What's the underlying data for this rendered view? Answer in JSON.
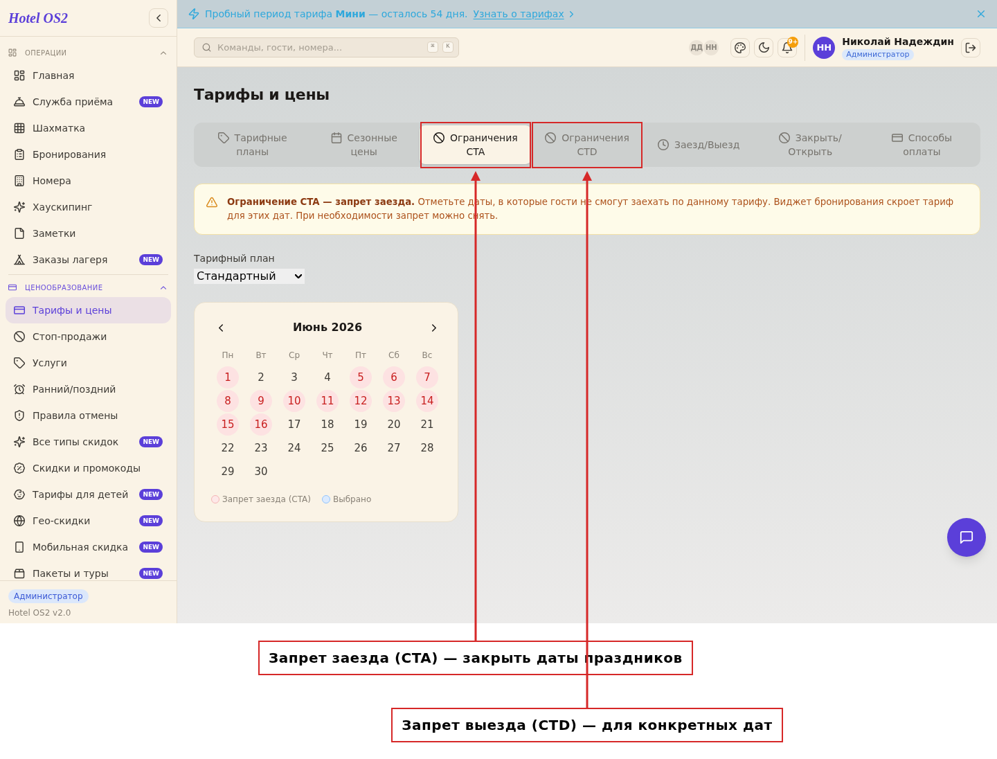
{
  "sidebar": {
    "logo": "Hotel OS2",
    "sections": [
      {
        "title": "ОПЕРАЦИИ",
        "expanded": true,
        "items": [
          {
            "label": "Главная",
            "selected": false
          },
          {
            "label": "Служба приёма",
            "badge": "NEW",
            "selected": false
          },
          {
            "label": "Шахматка",
            "selected": false
          },
          {
            "label": "Бронирования",
            "selected": false
          },
          {
            "label": "Номера",
            "selected": false
          },
          {
            "label": "Хаускипинг",
            "selected": false
          },
          {
            "label": "Заметки",
            "selected": false
          },
          {
            "label": "Заказы лагеря",
            "badge": "NEW",
            "selected": false
          }
        ]
      },
      {
        "title": "ЦЕНООБРАЗОВАНИЕ",
        "expanded": true,
        "items": [
          {
            "label": "Тарифы и цены",
            "selected": true
          },
          {
            "label": "Стоп-продажи",
            "selected": false
          },
          {
            "label": "Услуги",
            "selected": false
          },
          {
            "label": "Ранний/поздний",
            "selected": false
          },
          {
            "label": "Правила отмены",
            "selected": false
          },
          {
            "label": "Все типы скидок",
            "badge": "NEW",
            "selected": false
          },
          {
            "label": "Скидки и промокоды",
            "selected": false
          },
          {
            "label": "Тарифы для детей",
            "badge": "NEW",
            "selected": false
          },
          {
            "label": "Гео-скидки",
            "badge": "NEW",
            "selected": false
          },
          {
            "label": "Мобильная скидка",
            "badge": "NEW",
            "selected": false
          },
          {
            "label": "Пакеты и туры",
            "badge": "NEW",
            "selected": false
          }
        ]
      }
    ],
    "footer": {
      "role": "Администратор",
      "version": "Hotel OS2 v2.0"
    }
  },
  "banner": {
    "text": "Пробный период тарифа **Мини** — осталось 54 дня.",
    "link": "Узнать о тарифах"
  },
  "header": {
    "search": {
      "placeholder": "Команды, гости, номера...",
      "shortcut": [
        "⌘",
        "K"
      ]
    },
    "presence": [
      "ДД",
      "НН"
    ],
    "notifications": "9+",
    "user": {
      "initials": "НН",
      "name": "Николай Надеждин",
      "role": "Администратор"
    }
  },
  "page": {
    "title": "Тарифы и цены",
    "tabs": [
      {
        "label": "Тарифные планы",
        "selected": false,
        "highlighted": false
      },
      {
        "label": "Сезонные цены",
        "selected": false,
        "highlighted": false
      },
      {
        "label": "Ограничения CTA",
        "selected": true,
        "highlighted": true
      },
      {
        "label": "Ограничения CTD",
        "selected": false,
        "highlighted": true
      },
      {
        "label": "Заезд/Выезд",
        "selected": false,
        "highlighted": false
      },
      {
        "label": "Закрыть/Открыть",
        "selected": false,
        "highlighted": false
      },
      {
        "label": "Способы оплаты",
        "selected": false,
        "highlighted": false
      }
    ],
    "alert": "**Ограничение CTA — запрет заезда.** Отметьте даты, в которые гости не смогут заехать по данному тарифу. Виджет бронирования скроет тариф для этих дат. При необходимости запрет можно снять.",
    "plan": {
      "label": "Тарифный план",
      "value": "Стандартный"
    },
    "calendar": {
      "title": "Июнь 2026",
      "weekdays": [
        "Пн",
        "Вт",
        "Ср",
        "Чт",
        "Пт",
        "Сб",
        "Вс"
      ],
      "days": [
        {
          "label": "1",
          "blocked": true,
          "selected": false
        },
        {
          "label": "2",
          "blocked": false,
          "selected": false
        },
        {
          "label": "3",
          "blocked": false,
          "selected": false
        },
        {
          "label": "4",
          "blocked": false,
          "selected": false
        },
        {
          "label": "5",
          "blocked": true,
          "selected": false
        },
        {
          "label": "6",
          "blocked": true,
          "selected": false
        },
        {
          "label": "7",
          "blocked": true,
          "selected": false
        },
        {
          "label": "8",
          "blocked": true,
          "selected": false
        },
        {
          "label": "9",
          "blocked": true,
          "selected": false
        },
        {
          "label": "10",
          "blocked": true,
          "selected": false
        },
        {
          "label": "11",
          "blocked": true,
          "selected": false
        },
        {
          "label": "12",
          "blocked": true,
          "selected": false
        },
        {
          "label": "13",
          "blocked": true,
          "selected": false
        },
        {
          "label": "14",
          "blocked": true,
          "selected": false
        },
        {
          "label": "15",
          "blocked": true,
          "selected": false
        },
        {
          "label": "16",
          "blocked": true,
          "selected": false
        },
        {
          "label": "17",
          "blocked": false,
          "selected": false
        },
        {
          "label": "18",
          "blocked": false,
          "selected": false
        },
        {
          "label": "19",
          "blocked": false,
          "selected": false
        },
        {
          "label": "20",
          "blocked": false,
          "selected": false
        },
        {
          "label": "21",
          "blocked": false,
          "selected": false
        },
        {
          "label": "22",
          "blocked": false,
          "selected": false
        },
        {
          "label": "23",
          "blocked": false,
          "selected": false
        },
        {
          "label": "24",
          "blocked": false,
          "selected": false
        },
        {
          "label": "25",
          "blocked": false,
          "selected": false
        },
        {
          "label": "26",
          "blocked": false,
          "selected": false
        },
        {
          "label": "27",
          "blocked": false,
          "selected": false
        },
        {
          "label": "28",
          "blocked": false,
          "selected": false
        },
        {
          "label": "29",
          "blocked": false,
          "selected": false
        },
        {
          "label": "30",
          "blocked": false,
          "selected": false
        }
      ],
      "legend": [
        {
          "label": "Запрет заезда (CTA)",
          "kind": "blocked"
        },
        {
          "label": "Выбрано",
          "kind": "selected"
        }
      ]
    }
  },
  "annotations": [
    {
      "text": "Запрет заезда (CTA) — закрыть даты праздников"
    },
    {
      "text": "Запрет выезда (CTD) — для конкретных дат"
    }
  ]
}
